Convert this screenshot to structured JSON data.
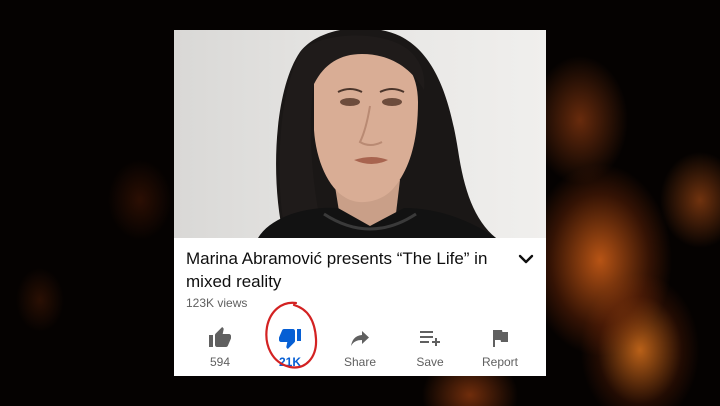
{
  "video": {
    "title": "Marina Abramović presents “The Life” in mixed reality",
    "views": "123K views"
  },
  "actions": [
    {
      "label": "594",
      "icon": "thumbs-up-icon"
    },
    {
      "label": "21K",
      "icon": "thumbs-down-icon",
      "selected": true
    },
    {
      "label": "Share",
      "icon": "share-icon"
    },
    {
      "label": "Save",
      "icon": "save-playlist-icon"
    },
    {
      "label": "Report",
      "icon": "flag-icon"
    }
  ],
  "colors": {
    "selected": "#065fd4",
    "annotation": "#d32222",
    "icon": "#606060"
  }
}
